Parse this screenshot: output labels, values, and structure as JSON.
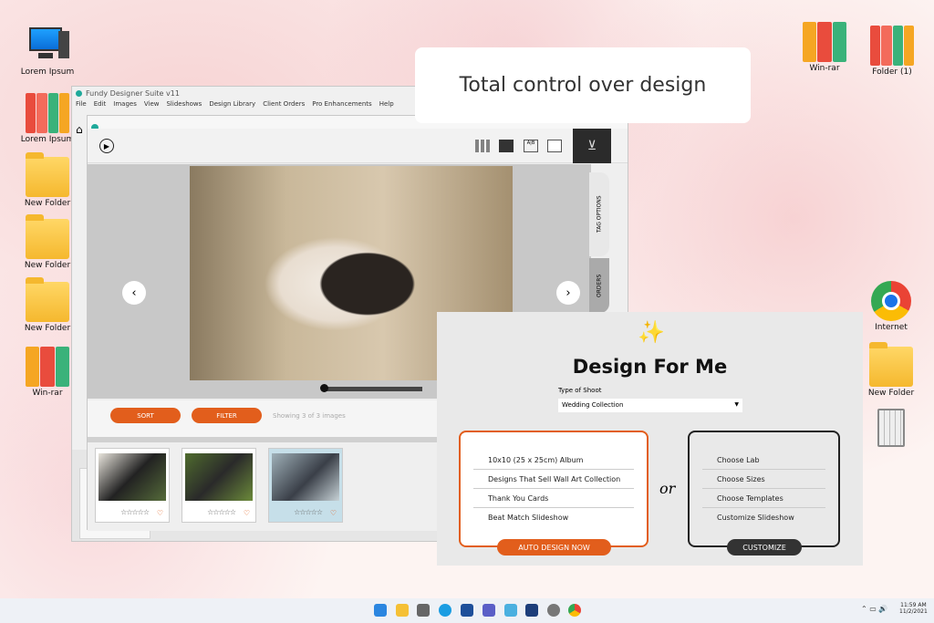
{
  "banner": "Total control over design",
  "desktop_left": [
    {
      "label": "Lorem Ipsum",
      "icon": "computer-icon"
    },
    {
      "label": "Lorem Ipsum",
      "icon": "binders-icon"
    },
    {
      "label": "New Folder",
      "icon": "folder-icon"
    },
    {
      "label": "New Folder",
      "icon": "folder-icon"
    },
    {
      "label": "New Folder",
      "icon": "folder-icon"
    },
    {
      "label": "Win-rar",
      "icon": "winrar-icon"
    }
  ],
  "desktop_right": [
    {
      "label": "Win-rar",
      "icon": "winrar-icon"
    },
    {
      "label": "Folder (1)",
      "icon": "binders-icon"
    },
    {
      "label": "Internet",
      "icon": "chrome-icon"
    },
    {
      "label": "New Folder",
      "icon": "folder-icon"
    },
    {
      "label": "",
      "icon": "recycle-bin-icon"
    }
  ],
  "app": {
    "title": "Fundy Designer Suite v11",
    "menu": [
      "File",
      "Edit",
      "Images",
      "View",
      "Slideshows",
      "Design Library",
      "Client Orders",
      "Pro Enhancements",
      "Help"
    ],
    "side_tabs": [
      "TAG OPTIONS",
      "ORDERS"
    ],
    "sort": "SORT",
    "filter": "FILTER",
    "showing": "Showing 3 of 3 images",
    "stars": "☆☆☆☆☆",
    "heart": "♡"
  },
  "dialog": {
    "title": "Design For Me",
    "type_label": "Type of Shoot",
    "type_value": "Wedding Collection",
    "auto_items": [
      "10x10 (25 x 25cm) Album",
      "Designs That Sell Wall Art Collection",
      "Thank You Cards",
      "Beat Match Slideshow"
    ],
    "auto_button": "AUTO DESIGN NOW",
    "or": "or",
    "custom_items": [
      "Choose Lab",
      "Choose Sizes",
      "Choose Templates",
      "Customize Slideshow"
    ],
    "custom_button": "CUSTOMIZE",
    "accent": "#e25e1c"
  },
  "taskbar": {
    "time": "11:59 AM",
    "date": "11/2/2021"
  }
}
